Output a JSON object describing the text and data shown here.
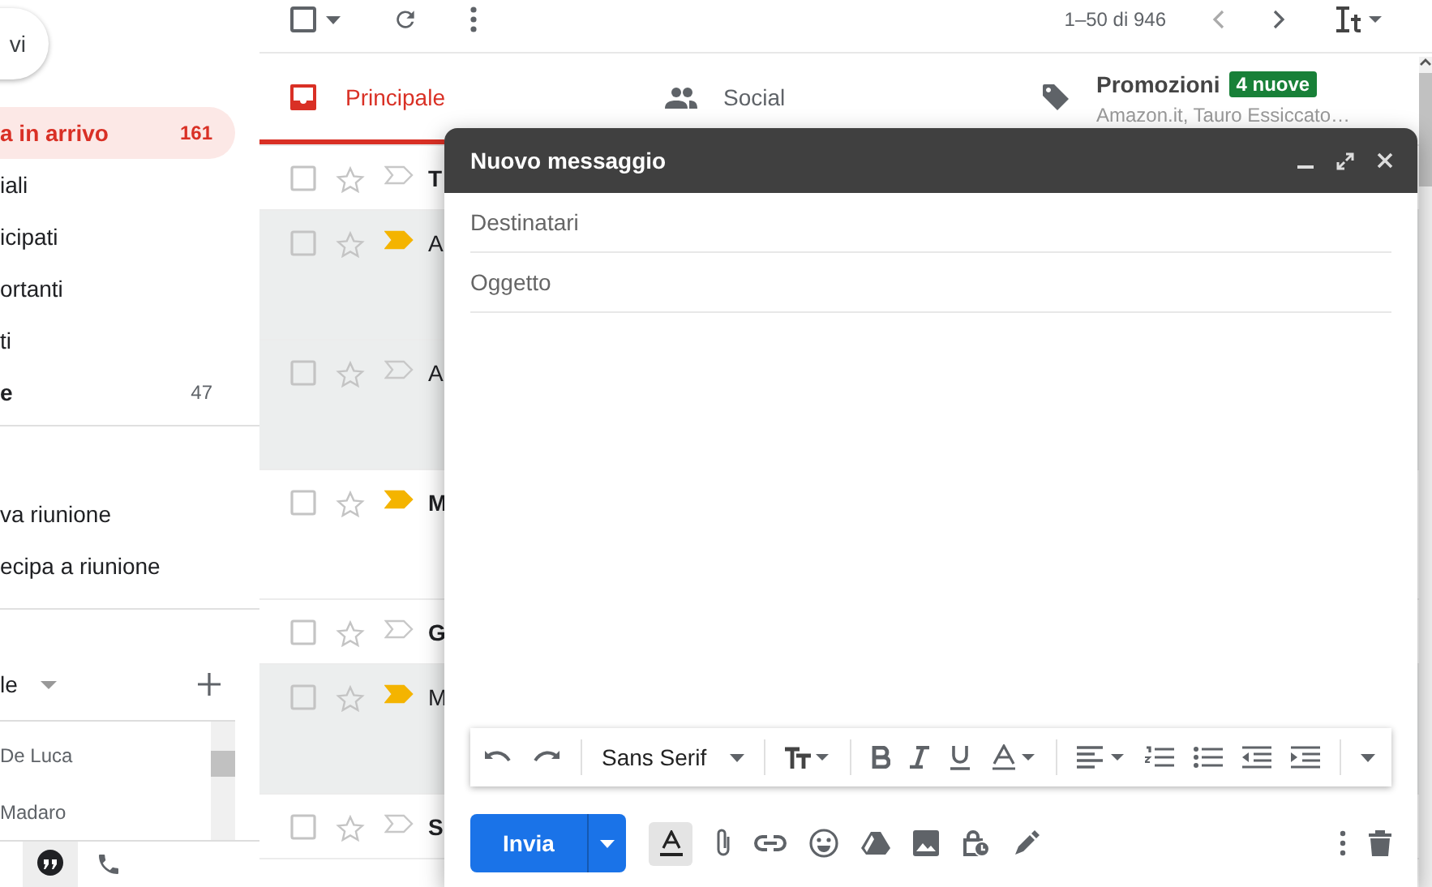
{
  "compose_button": {
    "label": "vi"
  },
  "sidebar": {
    "items": [
      {
        "label": "a in arrivo",
        "count": "161",
        "selected": true,
        "bold": true
      },
      {
        "label": "iali",
        "selected": false,
        "bold": false
      },
      {
        "label": "icipati",
        "selected": false,
        "bold": false
      },
      {
        "label": "ortanti",
        "selected": false,
        "bold": false
      },
      {
        "label": "ti",
        "selected": false,
        "bold": false
      },
      {
        "label": "e",
        "count": "47",
        "selected": false,
        "bold": true
      }
    ],
    "meet_items": [
      {
        "label": "va riunione"
      },
      {
        "label": "ecipa a riunione"
      }
    ],
    "hangouts": {
      "title": "le",
      "contacts": [
        {
          "name": "De Luca"
        },
        {
          "name": "Madaro"
        }
      ]
    }
  },
  "toolbar": {
    "select_checked": false,
    "pagination": "1–50 di 946"
  },
  "tabs": [
    {
      "kind": "primary",
      "label": "Principale",
      "selected": true
    },
    {
      "kind": "social",
      "label": "Social",
      "selected": false
    },
    {
      "kind": "promo",
      "label": "Promozioni",
      "badge": "4 nuove",
      "snippet": "Amazon.it, Tauro Essiccato…",
      "selected": false
    }
  ],
  "emails": [
    {
      "sender": "T",
      "unread": true,
      "important": false,
      "tall": false
    },
    {
      "sender": "A",
      "unread": false,
      "important": true,
      "tall": true
    },
    {
      "sender": "A",
      "unread": false,
      "important": false,
      "tall": true
    },
    {
      "sender": "M",
      "unread": true,
      "important": true,
      "tall": true
    },
    {
      "sender": "G",
      "unread": true,
      "important": false,
      "tall": false
    },
    {
      "sender": "M",
      "unread": false,
      "important": true,
      "tall": true
    },
    {
      "sender": "S",
      "unread": true,
      "important": false,
      "tall": false
    }
  ],
  "compose": {
    "title": "Nuovo messaggio",
    "to_placeholder": "Destinatari",
    "subject_placeholder": "Oggetto",
    "font": "Sans Serif",
    "send": "Invia"
  }
}
